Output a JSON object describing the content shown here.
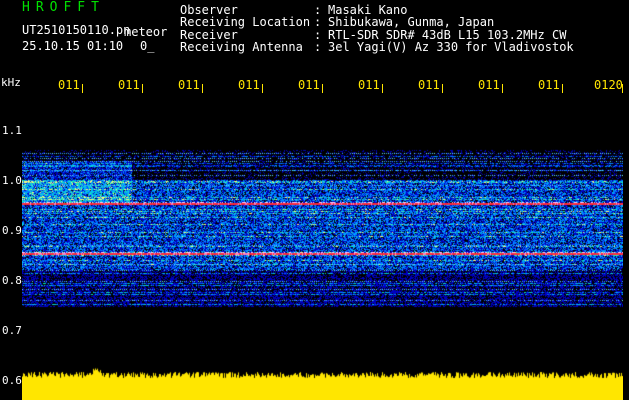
{
  "header": {
    "app_title": "HROFFT",
    "filename": "UT2510150110.pn",
    "filename_suffix": "meteor",
    "datetime": "25.10.15 01:10",
    "datetime_suffix": "0_",
    "fields": [
      {
        "label": "Observer",
        "separator": ":",
        "value": "Masaki Kano"
      },
      {
        "label": "Receiving Location",
        "separator": ":",
        "value": "Shibukawa, Gunma, Japan"
      },
      {
        "label": "Receiver",
        "separator": ":",
        "value": "RTL-SDR SDR# 43dB L15 103.2MHz CW"
      },
      {
        "label": "Receiving Antenna",
        "separator": ":",
        "value": "3el Yagi(V) Az 330 for Vladivostok"
      }
    ]
  },
  "time_axis": {
    "labels": [
      "011",
      "011",
      "011",
      "011",
      "011",
      "011",
      "011",
      "011",
      "011",
      "0120"
    ]
  },
  "freq_axis": {
    "unit": "kHz",
    "labels": [
      "1.1",
      "1.0",
      "0.9",
      "0.8",
      "0.7",
      "0.6"
    ]
  },
  "colors": {
    "background": "#000000",
    "accent_green": "#00e000",
    "accent_yellow": "#ffe600",
    "band_red": "#ff2a3a"
  }
}
